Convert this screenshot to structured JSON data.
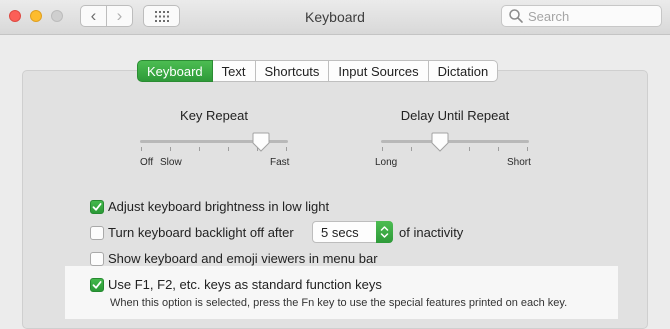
{
  "window": {
    "title": "Keyboard"
  },
  "toolbar": {
    "back_symbol": "‹",
    "forward_symbol": "›",
    "search_placeholder": "Search"
  },
  "tabs": [
    {
      "label": "Keyboard",
      "selected": true
    },
    {
      "label": "Text",
      "selected": false
    },
    {
      "label": "Shortcuts",
      "selected": false
    },
    {
      "label": "Input Sources",
      "selected": false
    },
    {
      "label": "Dictation",
      "selected": false
    }
  ],
  "key_repeat": {
    "title": "Key Repeat",
    "label_off": "Off",
    "label_slow": "Slow",
    "label_fast": "Fast",
    "position_fraction": 0.82
  },
  "delay_until_repeat": {
    "title": "Delay Until Repeat",
    "label_long": "Long",
    "label_short": "Short",
    "position_fraction": 0.4
  },
  "options": {
    "adjust_brightness": {
      "label": "Adjust keyboard brightness in low light",
      "checked": true
    },
    "backlight_off": {
      "label": "Turn keyboard backlight off after",
      "checked": false,
      "select_value": "5 secs",
      "suffix": "of inactivity"
    },
    "show_viewers": {
      "label": "Show keyboard and emoji viewers in menu bar",
      "checked": false
    },
    "function_keys": {
      "label": "Use F1, F2, etc. keys as standard function keys",
      "checked": true,
      "help": "When this option is selected, press the Fn key to use the special features printed on each key."
    }
  },
  "colors": {
    "accent_green": "#2e9a39",
    "close": "#fc5f57",
    "minimize": "#fdbc2e",
    "zoom_disabled": "#cfcfcf"
  }
}
